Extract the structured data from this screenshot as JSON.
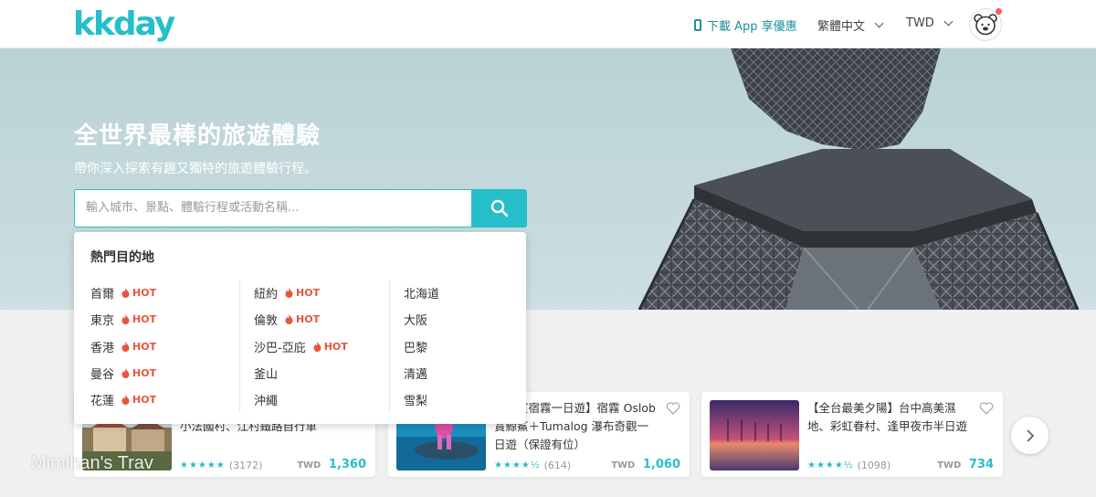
{
  "header": {
    "logo": "kkday",
    "app_link": "下載 App 享優惠",
    "language": "繁體中文",
    "currency": "TWD"
  },
  "hero": {
    "title": "全世界最棒的旅遊體驗",
    "subtitle": "帶你深入探索有趣又獨特的旅遊體驗行程。"
  },
  "search": {
    "placeholder": "輸入城市、景點、體驗行程或活動名稱..."
  },
  "dropdown": {
    "title": "熱門目的地",
    "hot_label": "HOT",
    "columns": [
      [
        {
          "name": "首爾",
          "hot": true
        },
        {
          "name": "東京",
          "hot": true
        },
        {
          "name": "香港",
          "hot": true
        },
        {
          "name": "曼谷",
          "hot": true
        },
        {
          "name": "花蓮",
          "hot": true
        }
      ],
      [
        {
          "name": "紐約",
          "hot": true
        },
        {
          "name": "倫敦",
          "hot": true
        },
        {
          "name": "沙巴-亞庇",
          "hot": true
        },
        {
          "name": "釜山",
          "hot": false
        },
        {
          "name": "沖繩",
          "hot": false
        }
      ],
      [
        {
          "name": "北海道",
          "hot": false
        },
        {
          "name": "大阪",
          "hot": false
        },
        {
          "name": "巴黎",
          "hot": false
        },
        {
          "name": "清邁",
          "hot": false
        },
        {
          "name": "雪梨",
          "hot": false
        }
      ]
    ]
  },
  "cards": [
    {
      "title": "小法國村、江村鐵路自行車",
      "rating": 5,
      "reviews": "(3172)",
      "currency": "TWD",
      "price": "1,360"
    },
    {
      "title": "菲律賓宿霧一日遊】宿霧 Oslob 賞鯨鯊＋Tumalog 瀑布奇觀一日遊（保證有位）",
      "rating": 4.5,
      "reviews": "(614)",
      "currency": "TWD",
      "price": "1,060"
    },
    {
      "title": "【全台最美夕陽】台中高美濕地、彩虹眷村、逢甲夜市半日遊",
      "rating": 4.5,
      "reviews": "(1098)",
      "currency": "TWD",
      "price": "734"
    }
  ],
  "watermark": "Mimihan's Trav",
  "colors": {
    "brand": "#26bec9",
    "hot": "#e8553e"
  }
}
